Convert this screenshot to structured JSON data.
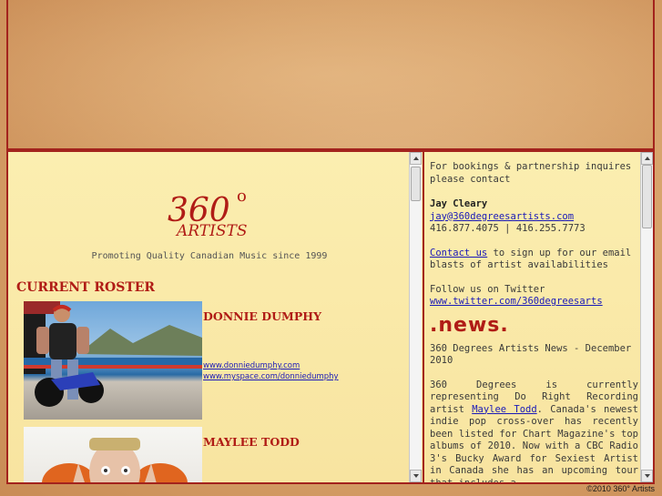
{
  "logo": {
    "number": "360",
    "degree": "o",
    "word": "ARTISTS"
  },
  "tagline": "Promoting Quality Canadian Music since 1999",
  "roster": {
    "heading": "CURRENT ROSTER",
    "artists": [
      {
        "name": "DONNIE DUMPHY",
        "links": [
          "www.donniedumphy.com",
          "www.myspace.com/donniedumphy"
        ]
      },
      {
        "name": "MAYLEE TODD",
        "links": []
      }
    ]
  },
  "sidebar": {
    "booking_intro": "For bookings & partnership inquires please contact",
    "contact_name": "Jay Cleary",
    "contact_email": "jay@360degreesartists.com",
    "contact_phones": "416.877.4075 | 416.255.7773",
    "contact_us_link": "Contact us",
    "contact_us_text": " to sign up for our email blasts of artist availabilities",
    "twitter_intro": "Follow us on Twitter",
    "twitter_link": "www.twitter.com/360degreesarts",
    "news_heading": ".news.",
    "news_title": "360 Degrees Artists News - December 2010",
    "news_body_1": "360 Degrees is currently representing Do Right Recording artist ",
    "news_artist_link": "Maylee Todd",
    "news_body_2": ". Canada's newest indie pop cross-over has recently been listed for Chart Magazine's top albums of 2010. Now with a CBC Radio 3's Bucky Award for Sexiest Artist in Canada she has an upcoming tour that includes a"
  },
  "footer": {
    "copyright": "©2010 360° Artists"
  },
  "colors": {
    "accent": "#b01c16",
    "frame": "#a3231d",
    "link": "#1a1ab8",
    "panel": "#f8e4a0"
  }
}
